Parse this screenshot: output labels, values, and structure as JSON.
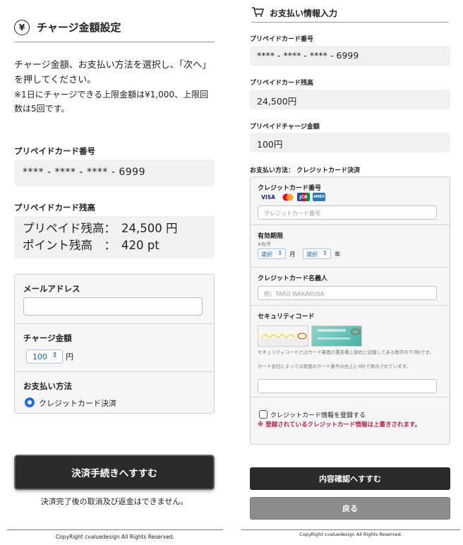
{
  "left": {
    "title": "チャージ金額設定",
    "yen_icon": "¥",
    "intro": "チャージ金額、お支払い方法を選択し、「次へ」を押してください。",
    "intro_note": "※1日にチャージできる上限金額は¥1,000、上限回数は5回です。",
    "card_number_label": "プリペイドカード番号",
    "card_number": "**** - **** - **** - 6999",
    "balance_label": "プリペイドカード残高",
    "prepaid_balance_key": "プリペイド残高：",
    "prepaid_balance_value": "24,500 円",
    "point_balance_key": "ポイント残高　：",
    "point_balance_value": "420 pt",
    "email_label": "メールアドレス",
    "email_value": "",
    "charge_label": "チャージ金額",
    "charge_selected": "100",
    "charge_unit": "円",
    "payment_label": "お支払い方法",
    "payment_option": "クレジットカード決済",
    "submit_button": "決済手続きへすすむ",
    "notice": "決済完了後の取消及び返金はできません。",
    "copyright": "CopyRight cvaluedesign All Rights Reserved."
  },
  "right": {
    "title": "お支払い情報入力",
    "card_number_label": "プリペイドカード番号",
    "card_number": "**** - **** - **** - 6999",
    "balance_label": "プリペイドカード残高",
    "balance": "24,500円",
    "charge_label": "プリペイドチャージ金額",
    "charge": "100円",
    "payment_method": "お支払い方法： クレジットカード決済",
    "cc_number_label": "クレジットカード番号",
    "cc_brands": [
      "VISA",
      "MC",
      "JCB",
      "AMEX"
    ],
    "cc_number_placeholder": "クレジットカード番号",
    "expiry_label": "有効期限",
    "expiry_sub": "※月/年",
    "month_select": "選択",
    "month_unit": "月",
    "year_select": "選択",
    "year_unit": "年",
    "holder_label": "クレジットカード名義人",
    "holder_placeholder": "例）TARO WAKAKUSA",
    "security_label": "セキュリティコード",
    "security_desc1": "セキュリティコードとはカード裏面の署名欄上部右に記載してある数字の下3桁です。",
    "security_desc2": "カード会社によっては表面のカード番号の右上に4桁で表示されています。",
    "security_value": "",
    "save_checkbox_label": "クレジットカード情報を登録する",
    "warning": "※ 登録されているクレジットカード情報は上書きされます。",
    "confirm_button": "内容確認へすすむ",
    "back_button": "戻る",
    "copyright": "CopyRight cvaluedesign All Rights Reserved."
  },
  "colors": {
    "accent_blue": "#1f6ed4",
    "button_dark": "#2a2a2a",
    "button_gray": "#8d8d8d",
    "warning_red": "#b0264a",
    "box_bg": "#f1f1f1"
  }
}
